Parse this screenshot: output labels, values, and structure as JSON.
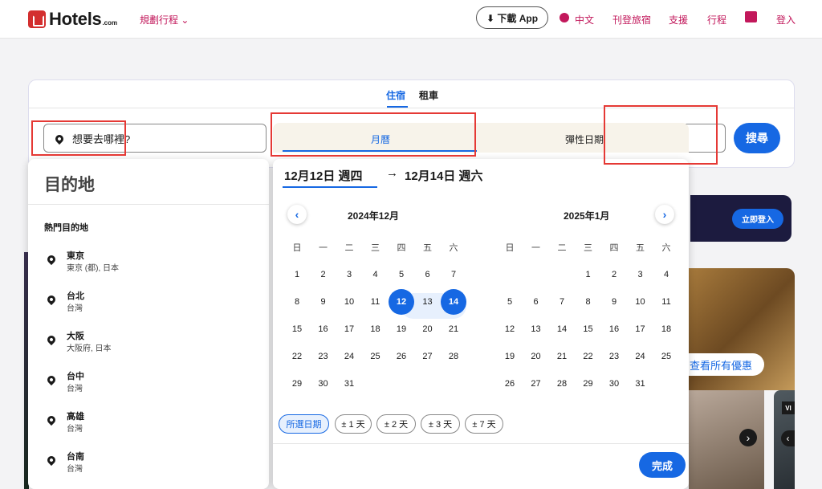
{
  "header": {
    "logo": "Hotels",
    "logo_suffix": ".com",
    "plan_trip": "規劃行程 ⌄",
    "download_app": "⬇ 下載 App",
    "language": "中文",
    "list_property": "刊登旅宿",
    "support": "支援",
    "trips": "行程",
    "sign_in": "登入"
  },
  "search": {
    "tabs": [
      "住宿",
      "租車"
    ],
    "active_tab": "住宿",
    "destination_placeholder": "想要去哪裡?",
    "search_button": "搜尋"
  },
  "destination_panel": {
    "title": "目的地",
    "popular_heading": "熱門目的地",
    "items": [
      {
        "name": "東京",
        "sub": "東京 (都), 日本"
      },
      {
        "name": "台北",
        "sub": "台灣"
      },
      {
        "name": "大阪",
        "sub": "大阪府, 日本"
      },
      {
        "name": "台中",
        "sub": "台灣"
      },
      {
        "name": "高雄",
        "sub": "台灣"
      },
      {
        "name": "台南",
        "sub": "台灣"
      }
    ]
  },
  "calendar": {
    "tabs": [
      "月曆",
      "彈性日期"
    ],
    "range_start": "12月12日 週四",
    "range_arrow": "→",
    "range_end": "12月14日 週六",
    "prev": "‹",
    "next": "›",
    "weekdays": [
      "日",
      "一",
      "二",
      "三",
      "四",
      "五",
      "六"
    ],
    "months": [
      {
        "title": "2024年12月",
        "weeks": [
          [
            "1",
            "2",
            "3",
            "4",
            "5",
            "6",
            "7"
          ],
          [
            "8",
            "9",
            "10",
            "11",
            "12",
            "13",
            "14"
          ],
          [
            "15",
            "16",
            "17",
            "18",
            "19",
            "20",
            "21"
          ],
          [
            "22",
            "23",
            "24",
            "25",
            "26",
            "27",
            "28"
          ],
          [
            "29",
            "30",
            "31",
            "",
            "",
            "",
            ""
          ]
        ]
      },
      {
        "title": "2025年1月",
        "weeks": [
          [
            "",
            "",
            "",
            "1",
            "2",
            "3",
            "4"
          ],
          [
            "5",
            "6",
            "7",
            "8",
            "9",
            "10",
            "11"
          ],
          [
            "12",
            "13",
            "14",
            "15",
            "16",
            "17",
            "18"
          ],
          [
            "19",
            "20",
            "21",
            "22",
            "23",
            "24",
            "25"
          ],
          [
            "26",
            "27",
            "28",
            "29",
            "30",
            "31",
            ""
          ]
        ]
      }
    ],
    "selected": [
      "12",
      "14"
    ],
    "flex_chips": [
      "所選日期",
      "± 1 天",
      "± 2 天",
      "± 3 天",
      "± 7 天"
    ],
    "done_button": "完成"
  },
  "background": {
    "signin_now": "立即登入",
    "view_all_deals": "查看所有優惠",
    "vi_tag": "VI",
    "arrow": "›",
    "arrow_left": "‹"
  },
  "colors": {
    "accent": "#1668e3",
    "brand": "#c2185b",
    "annotation": "#e53935"
  }
}
